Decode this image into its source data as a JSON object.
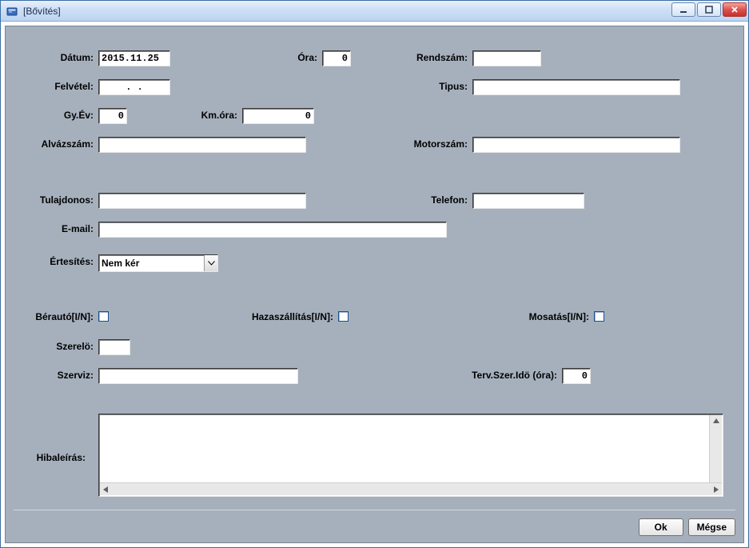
{
  "window": {
    "title": "[Bővítés]"
  },
  "labels": {
    "datum": "Dátum:",
    "ora": "Óra:",
    "rendszam": "Rendszám:",
    "felvetel": "Felvétel:",
    "tipus": "Tipus:",
    "gyev": "Gy.Év:",
    "kmora": "Km.óra:",
    "alvazszam": "Alvázszám:",
    "motorszam": "Motorszám:",
    "tulajdonos": "Tulajdonos:",
    "telefon": "Telefon:",
    "email": "E-mail:",
    "ertesites": "Értesítés:",
    "berato": "Bérautó[I/N]:",
    "hazaszallitas": "Hazaszállítás[I/N]:",
    "mosatas": "Mosatás[I/N]:",
    "szerelo": "Szerelö:",
    "szerviz": "Szerviz:",
    "tervszerido": "Terv.Szer.Idö (óra):",
    "hibaleiras": "Hibaleírás:"
  },
  "values": {
    "datum": "2015.11.25",
    "ora": "0",
    "rendszam": "",
    "felvetel": "  .  .",
    "tipus": "",
    "gyev": "0",
    "kmora": "0",
    "alvazszam": "",
    "motorszam": "",
    "tulajdonos": "",
    "telefon": "",
    "email": "",
    "ertesites": "Nem kér",
    "berato": false,
    "hazaszallitas": false,
    "mosatas": false,
    "szerelo": "",
    "szerviz": "",
    "tervszerido": "0",
    "hibaleiras": ""
  },
  "buttons": {
    "ok": "Ok",
    "cancel": "Mégse"
  }
}
